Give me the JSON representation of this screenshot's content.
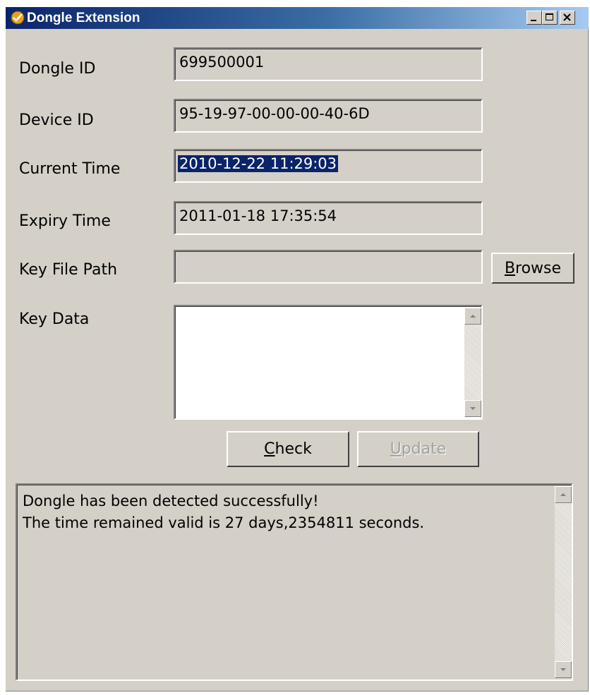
{
  "window": {
    "title": "Dongle Extension",
    "controls": {
      "minimize": "minimize",
      "maximize": "maximize",
      "close": "close"
    }
  },
  "fields": {
    "dongle_id": {
      "label": "Dongle ID",
      "value": "699500001"
    },
    "device_id": {
      "label": "Device ID",
      "value": "95-19-97-00-00-00-40-6D"
    },
    "current_time": {
      "label": "Current Time",
      "value": "2010-12-22 11:29:03"
    },
    "expiry_time": {
      "label": "Expiry Time",
      "value": "2011-01-18 17:35:54"
    },
    "key_file_path": {
      "label": "Key File Path",
      "value": ""
    },
    "key_data": {
      "label": "Key Data",
      "value": ""
    }
  },
  "buttons": {
    "browse": {
      "label": "Browse",
      "mnemonic": "B",
      "rest": "rowse"
    },
    "check": {
      "label": "Check",
      "mnemonic": "C",
      "rest": "heck"
    },
    "update": {
      "label": "Update",
      "mnemonic": "U",
      "rest": "pdate",
      "enabled": false
    }
  },
  "log": {
    "lines": [
      "Dongle has been detected successfully!",
      "The time remained valid is 27 days,2354811 seconds."
    ]
  },
  "icons": {
    "app": "dongle-app-icon",
    "scroll_up": "arrow-up-icon",
    "scroll_down": "arrow-down-icon"
  },
  "colors": {
    "face": "#d4d0c8",
    "title_start": "#0a246a",
    "title_end": "#a6caf0",
    "selection": "#0a246a"
  }
}
